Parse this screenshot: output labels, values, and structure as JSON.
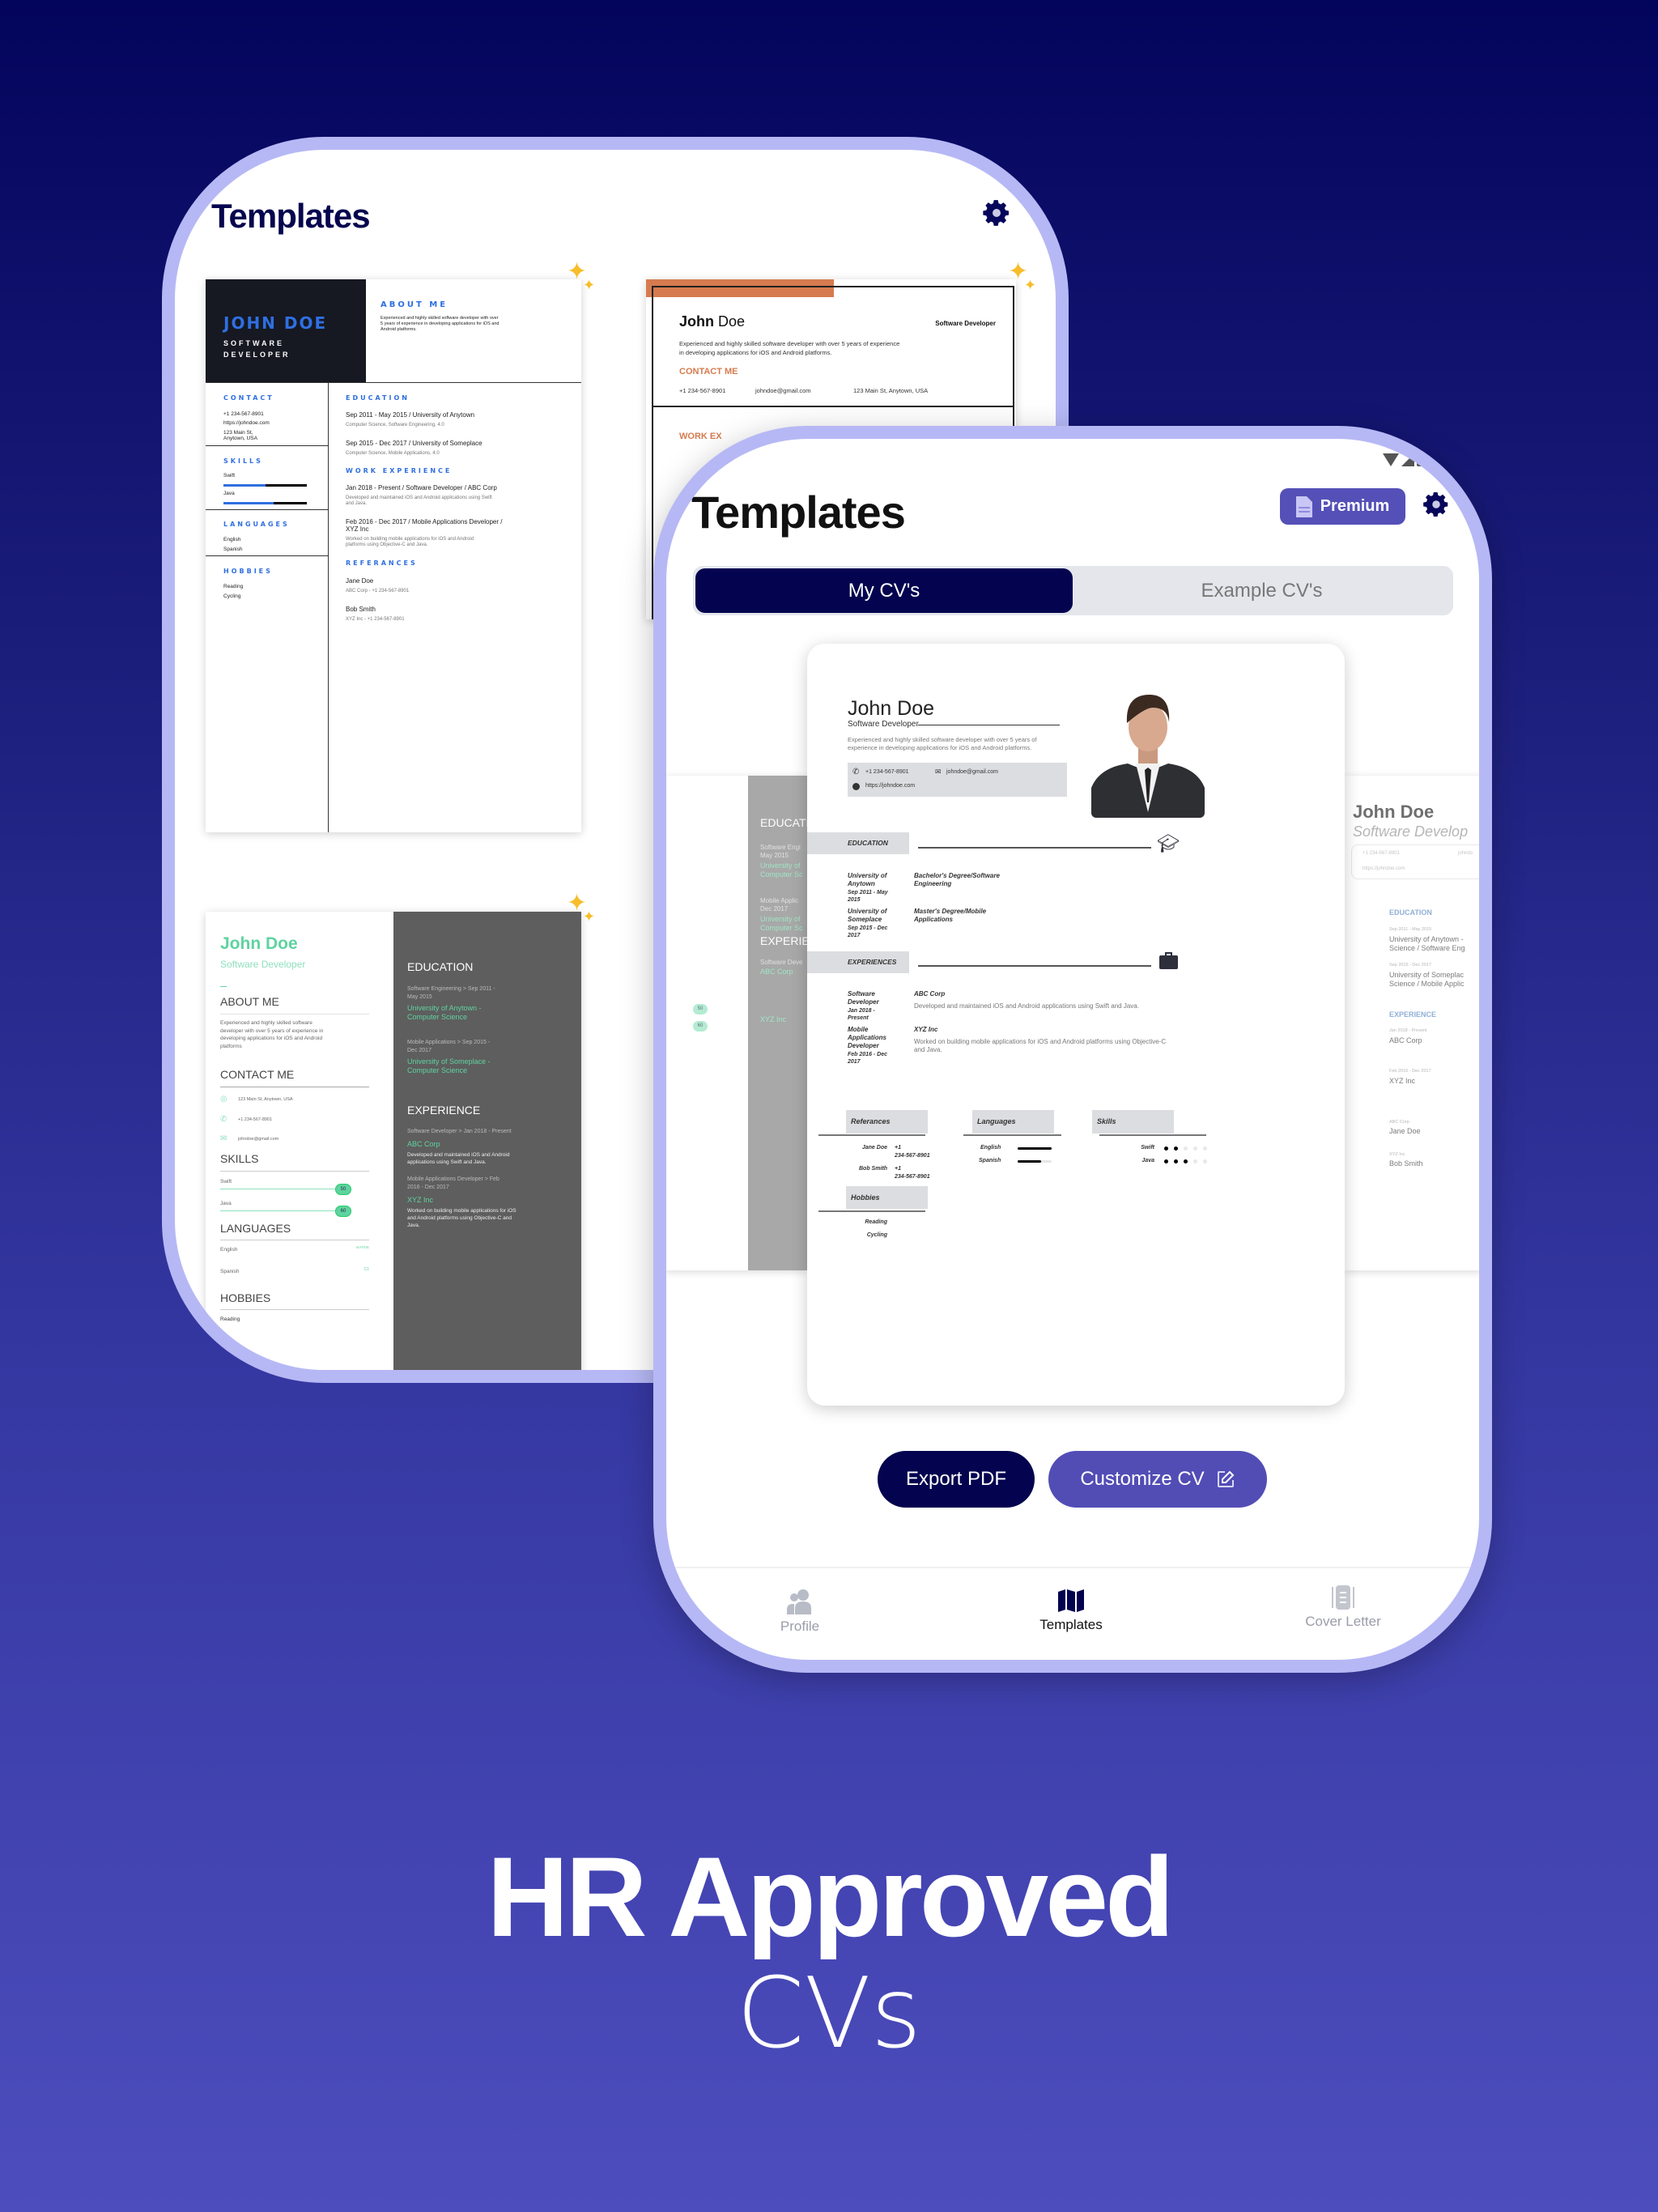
{
  "colors": {
    "background_top": "#03045c",
    "background_bottom": "#4d4dbd",
    "phone_frame": "#b6b8f5",
    "primary_dark": "#03034f",
    "accent": "#524db5",
    "sparkle": "#f7bd2a",
    "template_blue": "#2f6fe0",
    "template_orange": "#d67b4f",
    "template_green": "#5fd3a0"
  },
  "back_screen": {
    "title": "Templates",
    "settings_icon": "gear-icon",
    "template_1": {
      "name": "JOHN DOE",
      "role_1": "SOFTWARE",
      "role_2": "DEVELOPER",
      "about_h": "ABOUT ME",
      "about": [
        "Experienced and highly skilled software developer with over",
        "5 years of experience in developing applications for iOS and",
        "Android platforms."
      ],
      "contact_h": "CONTACT",
      "phone": "+1 234-567-8901",
      "web": "https://johndoe.com",
      "addr_1": "123 Main St,",
      "addr_2": "Anytown, USA",
      "skills_h": "SKILLS",
      "skills": [
        {
          "name": "Swift",
          "level": 0.5
        },
        {
          "name": "Java",
          "level": 0.6
        }
      ],
      "languages_h": "LANGUAGES",
      "languages": [
        "English",
        "Spanish"
      ],
      "hobbies_h": "HOBBIES",
      "hobbies": [
        "Reading",
        "Cycling"
      ],
      "education_h": "EDUCATION",
      "education": [
        {
          "title": "Sep 2011 - May 2015 / University of Anytown",
          "sub": "Computer Science, Software Engineering, 4.0"
        },
        {
          "title": "Sep 2015 - Dec 2017 / University of Someplace",
          "sub": "Computer Science, Mobile Applications, 4.0"
        }
      ],
      "work_h": "WORK EXPERIENCE",
      "work": [
        {
          "title": "Jan 2018 - Present / Software Developer / ABC Corp",
          "desc_1": "Developed and maintained iOS and Android applications using Swift",
          "desc_2": "and Java."
        },
        {
          "title": "Feb 2016 - Dec 2017 / Mobile Applications Developer /",
          "title_2": "XYZ Inc",
          "desc_1": "Worked on building mobile applications for iOS and Android",
          "desc_2": "platforms using Objective-C and Java."
        }
      ],
      "ref_h": "REFERANCES",
      "refs": [
        {
          "name": "Jane Doe",
          "sub": "ABC Corp - +1 234-567-8901"
        },
        {
          "name": "Bob Smith",
          "sub": "XYZ Inc - +1 234-567-8901"
        }
      ]
    },
    "template_2": {
      "first": "John",
      "last": "Doe",
      "role": "Software Developer",
      "summary_1": "Experienced and highly skilled software developer with over 5 years of experience",
      "summary_2": "in developing applications for iOS and Android platforms.",
      "contact_h": "CONTACT ME",
      "phone": "+1 234-567-8901",
      "email": "johndoe@gmail.com",
      "addr": "123 Main St, Anytown, USA",
      "work_h": "WORK EX"
    },
    "template_3": {
      "name": "John Doe",
      "role": "Software Developer",
      "about_h": "ABOUT ME",
      "about": [
        "Experienced and highly skilled software",
        "developer with over 5 years of experience in",
        "developing applications for iOS and Android",
        "platforms"
      ],
      "contact_h": "CONTACT ME",
      "addr": "123 Main St, Anytown, USA",
      "phone": "+1 234-567-8901",
      "email": "johndoe@gmail.com",
      "skills_h": "SKILLS",
      "skills": [
        {
          "name": "Swift",
          "value": "50"
        },
        {
          "name": "Java",
          "value": "60"
        }
      ],
      "languages_h": "LANGUAGES",
      "languages": [
        {
          "name": "English",
          "level": "NATIVE"
        },
        {
          "name": "Spanish",
          "level": "C1"
        }
      ],
      "hobbies_h": "HOBBIES",
      "hobbies": [
        "Reading"
      ],
      "education_h": "EDUCATION",
      "education": [
        {
          "l1": "Software Engineering > Sep 2011 -",
          "l2": "May 2015",
          "g1": "University of Anytown -",
          "g2": "Computer Science"
        },
        {
          "l1": "Mobile Applications > Sep 2015 -",
          "l2": "Dec 2017",
          "g1": "University of Someplace -",
          "g2": "Computer Science"
        }
      ],
      "experience_h": "EXPERIENCE",
      "experience": [
        {
          "l1": "Software Developer > Jan 2018 - Present",
          "l2": "",
          "company": "ABC Corp",
          "d1": "Developed and maintained iOS and Android",
          "d2": "applications using Swift and Java."
        },
        {
          "l1": "Mobile Applications Developer > Feb",
          "l2": "2016 - Dec 2017",
          "company": "XYZ Inc",
          "d1": "Worked on building mobile applications for iOS",
          "d2": "and Android platforms using Objective-C and",
          "d3": "Java."
        }
      ]
    }
  },
  "front_screen": {
    "title": "Templates",
    "premium_label": "Premium",
    "settings_icon": "gear-icon",
    "tabs": [
      {
        "label": "My CV's",
        "active": true
      },
      {
        "label": "Example CV's",
        "active": false
      }
    ],
    "cv": {
      "name": "John Doe",
      "role": "Software Developer",
      "summary_1": "Experienced and highly skilled software developer with over 5 years of",
      "summary_2": "experience in developing applications for iOS and Android platforms.",
      "phone": "+1 234-567-8901",
      "email": "johndoe@gmail.com",
      "web": "https://johndoe.com",
      "education_h": "EDUCATION",
      "education": [
        {
          "school_1": "University of",
          "school_2": "Anytown",
          "dates_1": "Sep 2011 - May",
          "dates_2": "2015",
          "degree_1": "Bachelor's Degree/Software",
          "degree_2": "Engineering"
        },
        {
          "school_1": "University of",
          "school_2": "Someplace",
          "dates_1": "Sep 2015 - Dec",
          "dates_2": "2017",
          "degree_1": "Master's Degree/Mobile",
          "degree_2": "Applications"
        }
      ],
      "experiences_h": "EXPERIENCES",
      "experiences": [
        {
          "role_1": "Software",
          "role_2": "Developer",
          "role_3": "",
          "dates_1": "Jan 2018 -",
          "dates_2": "Present",
          "company": "ABC Corp",
          "desc_1": "Developed and maintained iOS and Android applications using Swift and Java.",
          "desc_2": ""
        },
        {
          "role_1": "Mobile",
          "role_2": "Applications",
          "role_3": "Developer",
          "dates_1": "Feb 2016 - Dec",
          "dates_2": "2017",
          "company": "XYZ Inc",
          "desc_1": "Worked on building mobile applications for iOS and Android platforms using Objective-C",
          "desc_2": "and Java."
        }
      ],
      "references_h": "Referances",
      "references": [
        {
          "name": "Jane Doe",
          "phone_1": "+1",
          "phone_2": "234-567-8901"
        },
        {
          "name": "Bob Smith",
          "phone_1": "+1",
          "phone_2": "234-567-8901"
        }
      ],
      "hobbies_h": "Hobbies",
      "hobbies": [
        "Reading",
        "Cycling"
      ],
      "languages_h": "Languages",
      "languages": [
        {
          "name": "English",
          "level": 1.0
        },
        {
          "name": "Spanish",
          "level": 0.7
        }
      ],
      "skills_h": "Skills",
      "skills": [
        {
          "name": "Swift",
          "rating": 2,
          "max": 5
        },
        {
          "name": "Java",
          "rating": 3,
          "max": 5
        }
      ]
    },
    "side_left": {
      "education_h": "EDUCATION",
      "e1": "Software Engi",
      "e2": "May 2015",
      "e3": "University of",
      "e4": "Computer Sc",
      "e5": "Mobile Applic",
      "e6": "Dec 2017",
      "e7": "University of",
      "e8": "Computer Sc",
      "experience_h": "EXPERIEN",
      "x1": "Software Deve",
      "x2": "ABC Corp",
      "x3": "XYZ Inc",
      "v1": "50",
      "v2": "60"
    },
    "side_right": {
      "name": "John Doe",
      "role": "Software Develop",
      "phone": "+1 234-567-8901",
      "email": "johndo",
      "web": "https://johndoe.com",
      "education_h": "EDUCATION",
      "ed1_date": "Sep 2011 - May 2015",
      "ed1_1": "University of Anytown -",
      "ed1_2": "Science / Software Eng",
      "ed2_date": "Sep 2015 - Dec 2017",
      "ed2_1": "University of Someplac",
      "ed2_2": "Science / Mobile Applic",
      "experience_h": "EXPERIENCE",
      "ex1_date": "Jan 2018 - Present",
      "ex1": "ABC Corp",
      "ex2_date": "Feb 2016 - Dec 2017",
      "ex2": "XYZ Inc",
      "r1_co": "ABC Corp",
      "r1": "Jane Doe",
      "r2_co": "XYZ Inc",
      "r2": "Bob Smith"
    },
    "export_label": "Export PDF",
    "customize_label": "Customize CV",
    "nav": [
      {
        "label": "Profile",
        "icon": "people-icon",
        "active": false
      },
      {
        "label": "Templates",
        "icon": "map-icon",
        "active": true
      },
      {
        "label": "Cover Letter",
        "icon": "document-icon",
        "active": false
      }
    ]
  },
  "headline": {
    "line_1": "HR Approved",
    "line_2": "CVs"
  }
}
